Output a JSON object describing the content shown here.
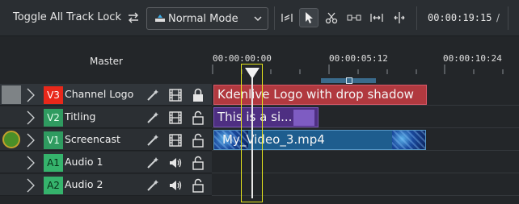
{
  "toolbar": {
    "toggle_lock_label": "Toggle All Track Lock",
    "mode": {
      "selected": "Normal Mode"
    },
    "timecode": "00:00:19:15",
    "timecode_sep": "/",
    "tools": [
      "spacer-tool",
      "select-tool",
      "razor-tool",
      "ripple-tool",
      "slip-tool",
      "slide-tool"
    ]
  },
  "timeline": {
    "master_label": "Master",
    "ruler": [
      "00:00:00:00",
      "00:00:05:12",
      "00:00:10:24"
    ]
  },
  "tracks": [
    {
      "tag": "V3",
      "name": "Channel Logo",
      "type": "video",
      "clip": "Kdenlive Logo with drop shadow"
    },
    {
      "tag": "V2",
      "name": "Titling",
      "type": "video",
      "clip": "This is a si..."
    },
    {
      "tag": "V1",
      "name": "Screencast",
      "type": "video",
      "clip": "My_Video_3.mp4",
      "badge": "1"
    },
    {
      "tag": "A1",
      "name": "Audio 1",
      "type": "audio"
    },
    {
      "tag": "A2",
      "name": "Audio 2",
      "type": "audio"
    }
  ],
  "colors": {
    "v3_tag": "#e8281a",
    "video_tag": "#2f9b60",
    "audio_tag": "#35b36c",
    "playhead_zone": "#e7e71c"
  }
}
